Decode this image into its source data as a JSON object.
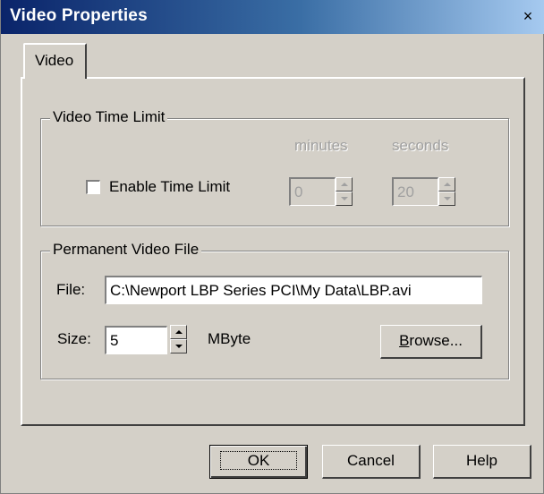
{
  "window": {
    "title": "Video Properties",
    "close_glyph": "×"
  },
  "tabs": [
    {
      "label": "Video"
    }
  ],
  "time_limit_group": {
    "title": "Video Time Limit",
    "enable_label": "Enable Time Limit",
    "enabled": false,
    "minutes_label": "minutes",
    "seconds_label": "seconds",
    "minutes_value": "0",
    "seconds_value": "20"
  },
  "file_group": {
    "title": "Permanent Video File",
    "file_label": "File:",
    "file_value": "C:\\Newport LBP Series PCI\\My Data\\LBP.avi",
    "size_label": "Size:",
    "size_value": "5",
    "size_unit": "MByte",
    "browse_underlined": "B",
    "browse_rest": "rowse..."
  },
  "buttons": {
    "ok": "OK",
    "cancel": "Cancel",
    "help": "Help"
  }
}
